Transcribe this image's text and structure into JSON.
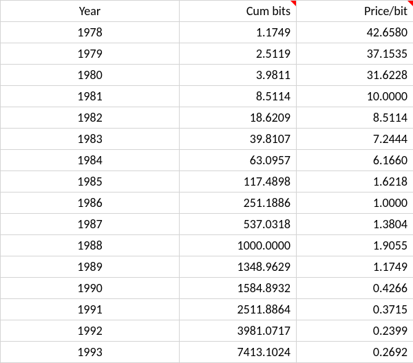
{
  "headers": {
    "year": "Year",
    "cumbits": "Cum bits",
    "pricebit": "Price/bit"
  },
  "rows": [
    {
      "year": "1978",
      "cumbits": "1.1749",
      "pricebit": "42.6580"
    },
    {
      "year": "1979",
      "cumbits": "2.5119",
      "pricebit": "37.1535"
    },
    {
      "year": "1980",
      "cumbits": "3.9811",
      "pricebit": "31.6228"
    },
    {
      "year": "1981",
      "cumbits": "8.5114",
      "pricebit": "10.0000"
    },
    {
      "year": "1982",
      "cumbits": "18.6209",
      "pricebit": "8.5114"
    },
    {
      "year": "1983",
      "cumbits": "39.8107",
      "pricebit": "7.2444"
    },
    {
      "year": "1984",
      "cumbits": "63.0957",
      "pricebit": "6.1660"
    },
    {
      "year": "1985",
      "cumbits": "117.4898",
      "pricebit": "1.6218"
    },
    {
      "year": "1986",
      "cumbits": "251.1886",
      "pricebit": "1.0000"
    },
    {
      "year": "1987",
      "cumbits": "537.0318",
      "pricebit": "1.3804"
    },
    {
      "year": "1988",
      "cumbits": "1000.0000",
      "pricebit": "1.9055"
    },
    {
      "year": "1989",
      "cumbits": "1348.9629",
      "pricebit": "1.1749"
    },
    {
      "year": "1990",
      "cumbits": "1584.8932",
      "pricebit": "0.4266"
    },
    {
      "year": "1991",
      "cumbits": "2511.8864",
      "pricebit": "0.3715"
    },
    {
      "year": "1992",
      "cumbits": "3981.0717",
      "pricebit": "0.2399"
    },
    {
      "year": "1993",
      "cumbits": "7413.1024",
      "pricebit": "0.2692"
    }
  ]
}
